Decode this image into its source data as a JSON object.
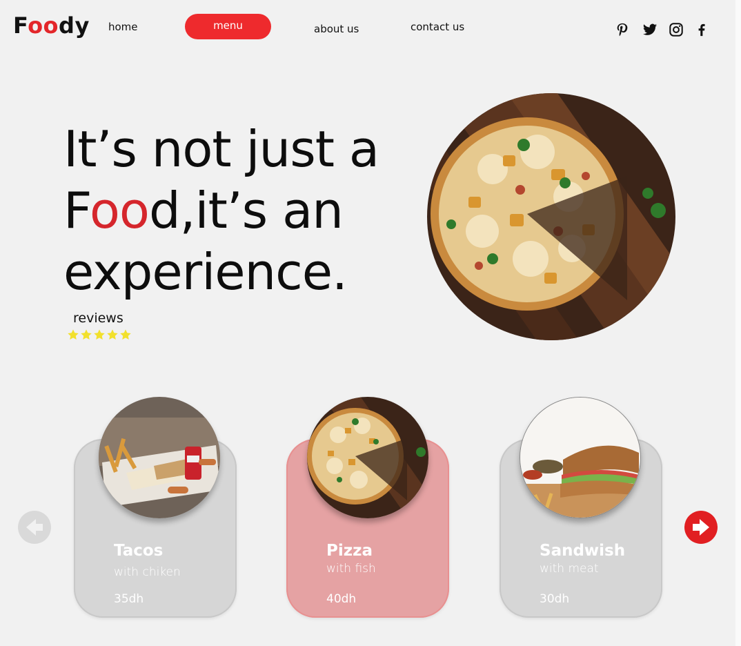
{
  "brand": {
    "prefix": "F",
    "accent": "oo",
    "suffix": "dy",
    "accent_color": "#e3262a"
  },
  "nav": {
    "home": "home",
    "menu": "menu",
    "about": "about us",
    "contact": "contact us"
  },
  "social": [
    "pinterest-icon",
    "twitter-icon",
    "instagram-icon",
    "facebook-icon"
  ],
  "hero": {
    "line1": "It’s not just a",
    "line2_prefix": "F",
    "line2_accent": "oo",
    "line2_suffix": "d,it’s an",
    "line3": "experience.",
    "reviews_label": "reviews",
    "rating": 5,
    "image": "pizza-photo"
  },
  "cards": [
    {
      "name": "Tacos",
      "sub": "with chiken",
      "price": "35dh",
      "image": "tacos-photo"
    },
    {
      "name": "Pizza",
      "sub": "with fish",
      "price": "40dh",
      "image": "pizza-photo"
    },
    {
      "name": "Sandwish",
      "sub": "with meat",
      "price": "30dh",
      "image": "sandwich-photo"
    }
  ],
  "colors": {
    "accent": "#ee2a2d",
    "background": "#f1f1f1",
    "card": "#d6d6d6",
    "card_active": "#e5a2a3",
    "star": "#f2e02c",
    "arrow_disabled": "#d9d9d9"
  }
}
